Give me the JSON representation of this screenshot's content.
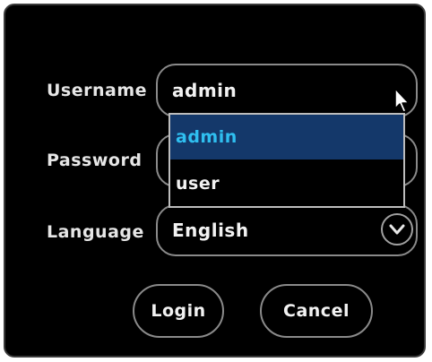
{
  "login_dialog": {
    "username": {
      "label": "Username",
      "value": "admin"
    },
    "username_options": {
      "items": [
        "admin",
        "user"
      ],
      "selected": "admin"
    },
    "password": {
      "label": "Password",
      "value": ""
    },
    "language": {
      "label": "Language",
      "value": "English",
      "dropdown_icon": "chevron-down-icon"
    },
    "buttons": {
      "login": "Login",
      "cancel": "Cancel"
    }
  },
  "colors": {
    "background": "#000000",
    "border": "#8a8a8a",
    "text": "#f2f2f2",
    "selected_bg": "#14386a",
    "selected_text": "#2fbff0"
  }
}
